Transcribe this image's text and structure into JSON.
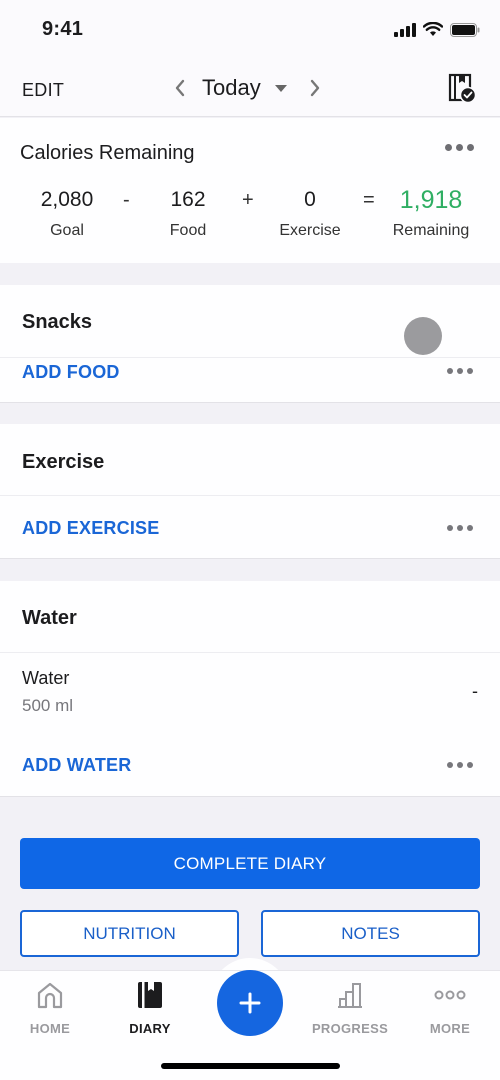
{
  "status_bar": {
    "time": "9:41"
  },
  "header": {
    "edit_label": "EDIT",
    "date_label": "Today",
    "right_icon": "diary-complete-icon"
  },
  "calories": {
    "title": "Calories Remaining",
    "goal": {
      "value": "2,080",
      "label": "Goal"
    },
    "food": {
      "value": "162",
      "label": "Food"
    },
    "exercise": {
      "value": "0",
      "label": "Exercise"
    },
    "remaining": {
      "value": "1,918",
      "label": "Remaining"
    },
    "operators": {
      "minus": "-",
      "plus": "+",
      "equals": "="
    },
    "remaining_color": "#2fae63"
  },
  "sections": {
    "snacks": {
      "title": "Snacks",
      "add_label": "ADD FOOD"
    },
    "exercise": {
      "title": "Exercise",
      "add_label": "ADD EXERCISE"
    },
    "water": {
      "title": "Water",
      "entry": {
        "name": "Water",
        "amount": "500 ml",
        "calories": "-"
      },
      "add_label": "ADD WATER"
    }
  },
  "actions": {
    "complete_diary": "COMPLETE DIARY",
    "nutrition": "NUTRITION",
    "notes": "NOTES"
  },
  "tabbar": {
    "items": [
      {
        "label": "HOME",
        "icon": "home-icon",
        "active": false
      },
      {
        "label": "DIARY",
        "icon": "diary-icon",
        "active": true
      },
      {
        "label": "PROGRESS",
        "icon": "progress-icon",
        "active": false
      },
      {
        "label": "MORE",
        "icon": "more-icon",
        "active": false
      }
    ],
    "fab_icon": "plus-icon"
  },
  "colors": {
    "accent": "#1566e0",
    "link": "#1a66d6",
    "success": "#2fae63",
    "background": "#f2f1f6"
  }
}
